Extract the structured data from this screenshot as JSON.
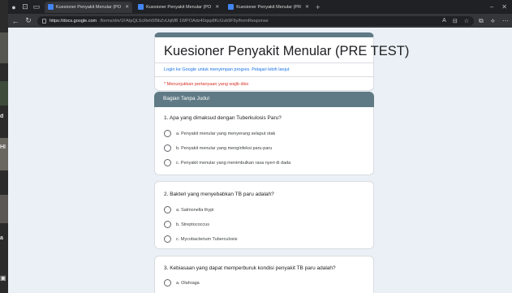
{
  "left_strip": {
    "labels": [
      "d",
      "HI",
      "a"
    ]
  },
  "tabs": [
    {
      "label": "Kuesioner Penyakit Menular (PO",
      "active": true
    },
    {
      "label": "Kuesioner Penyakit Menular (PO",
      "active": false
    },
    {
      "label": "Kuesioner Penyakit Menular (PR",
      "active": false
    }
  ],
  "address": {
    "host": "https://docs.google.com",
    "path": "/forms/d/e/1FAIpQLScReh5f9bZvUqMB 1WPOAdz40qxp8KcGvb9F9y/formResponse"
  },
  "form": {
    "title": "Kuesioner Penyakit Menular (PRE TEST)",
    "login_text": "Login ke Google untuk menyimpan progres. Pelajari lebih lanjut",
    "required_note": "* Menunjukkan pertanyaan yang wajib diisi",
    "section_title": "Bagian Tanpa Judul",
    "questions": [
      {
        "text": "1. Apa yang dimaksud dengan Tuberkulosis Paru?",
        "options": [
          "a. Penyakit menular yang menyerang selaput otak",
          "b. Penyakit menular yang menginfeksi paru-paru",
          "c. Penyakit menular yang menimbulkan rasa nyeri di dada"
        ]
      },
      {
        "text": "2. Bakteri yang menyebabkan TB paru adalah?",
        "options": [
          "a. Salmonella thypi",
          "b. Streptococcus",
          "c. Mycobacterium Tuberculosis"
        ]
      },
      {
        "text": "3. Kebiasaan yang dapat memperburuk kondisi penyakit TB paru adalah?",
        "options": [
          "a. Olahraga"
        ]
      }
    ]
  },
  "colors": {
    "theme": "#5f7a85",
    "background": "#eaf0f5",
    "required": "#d93025",
    "link": "#1a73e8"
  }
}
